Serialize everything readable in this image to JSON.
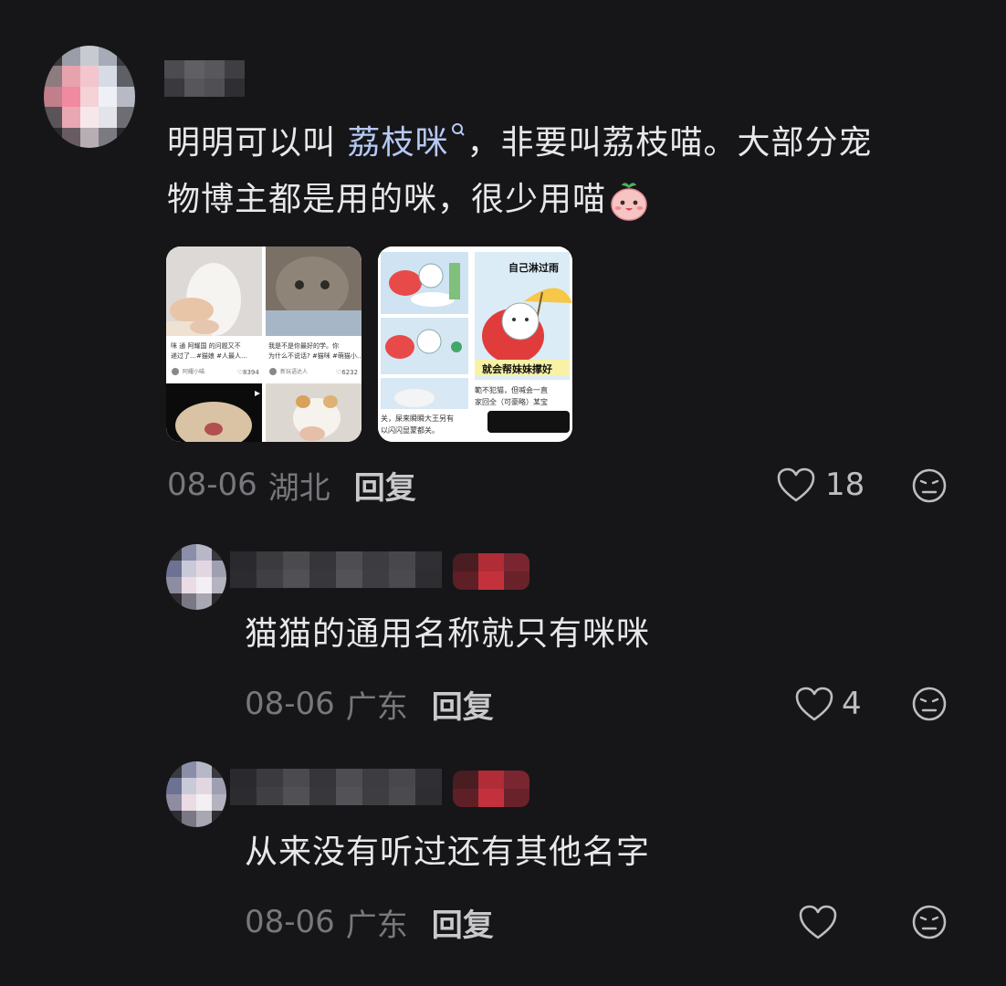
{
  "comments": [
    {
      "text_part1": "明明可以叫 ",
      "keyword": "荔枝咪",
      "text_part2": "，非要叫荔枝喵。大部分宠",
      "text_line2": "物博主都是用的咪，很少用喵",
      "date": "08-06",
      "region": "湖北",
      "reply_label": "回复",
      "likes": "18"
    },
    {
      "text": "猫猫的通用名称就只有咪咪",
      "date": "08-06",
      "region": "广东",
      "reply_label": "回复",
      "likes": "4"
    },
    {
      "text": "从来没有听过还有其他名字",
      "date": "08-06",
      "region": "广东",
      "reply_label": "回复",
      "likes": ""
    }
  ],
  "image1": {
    "card1_caption": "咪 通 阿耀国 的问题又不 递过了…#猫娘 #人最人…",
    "card1_likes": "8394",
    "card2_caption": "我是不是你最好的学。你 为什么不说话? #猫咪 #萌猫小…",
    "card2_likes": "6232"
  },
  "image2": {
    "title_top": "自己淋过雨",
    "title_bottom": "就会帮妹妹撑好",
    "bottom_left_text": "关，屎来瞬瞬大王另有 以闪闪显蒙都关。",
    "bottom_right_text": "範不犯猫，但喊会一直 家回全（可豪略）某宝"
  },
  "colors": {
    "background": "#161618",
    "keyword": "#b6c8f3",
    "meta": "#77777c"
  }
}
